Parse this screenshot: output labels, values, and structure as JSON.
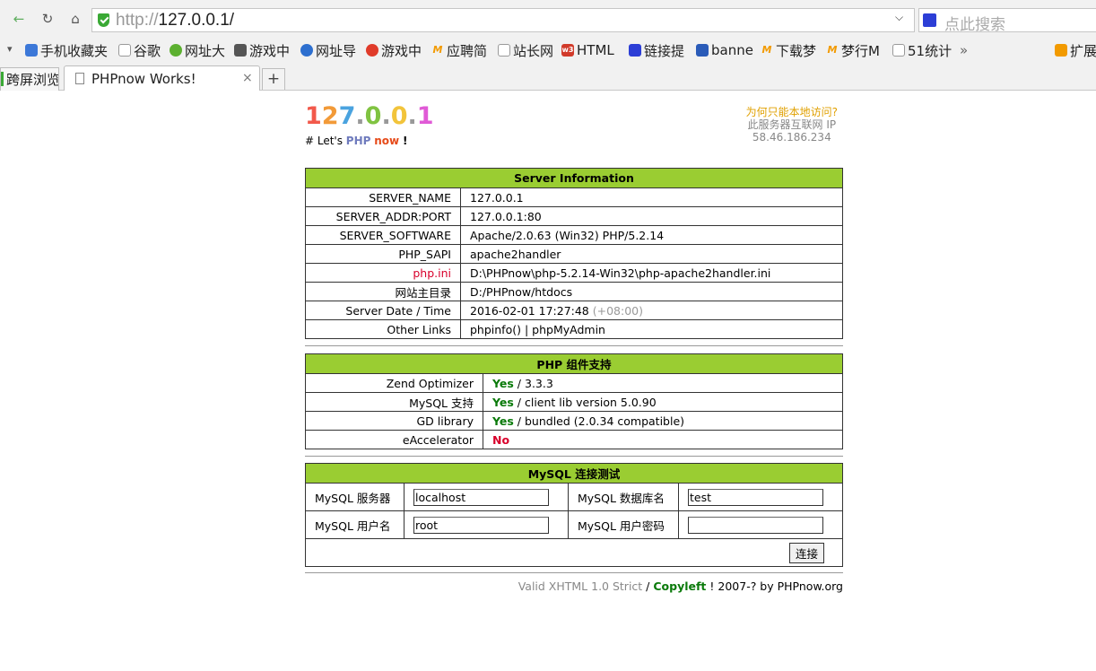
{
  "browser": {
    "url_protocol": "http://",
    "url_host": "127.0.0.1/",
    "search_placeholder": "点此搜索",
    "bookmarks": [
      "手机收藏夹",
      "谷歌",
      "网址大",
      "游戏中",
      "网址导",
      "游戏中",
      "应聘简",
      "站长网",
      "HTML",
      "链接提",
      "banne",
      "下载梦",
      "梦行M",
      "51统计",
      "扩展"
    ],
    "bookmark_overflow": "»",
    "left_ext": "跨屏浏览",
    "tab_title": "PHPnow Works!",
    "tab_close": "×",
    "new_tab": "+"
  },
  "header": {
    "logo_chars": [
      "1",
      "2",
      "7",
      ".",
      "0",
      ".",
      "0",
      ".",
      "1"
    ],
    "tagline_prefix": "# Let's ",
    "tagline_php": "PHP",
    "tagline_now": "now",
    "tagline_bang": "!",
    "ip_question": "为何只能本地访问?",
    "ip_label": "此服务器互联网 IP",
    "ip_value": "58.46.186.234"
  },
  "server_info": {
    "title": "Server Information",
    "rows": [
      {
        "key": "SERVER_NAME",
        "value": "127.0.0.1"
      },
      {
        "key": "SERVER_ADDR:PORT",
        "value": "127.0.0.1:80"
      },
      {
        "key": "SERVER_SOFTWARE",
        "value": "Apache/2.0.63 (Win32) PHP/5.2.14"
      },
      {
        "key": "PHP_SAPI",
        "value": "apache2handler"
      },
      {
        "key": "php.ini",
        "value": "D:\\PHPnow\\php-5.2.14-Win32\\php-apache2handler.ini"
      },
      {
        "key": "网站主目录",
        "value": "D:/PHPnow/htdocs"
      },
      {
        "key": "Server Date / Time",
        "value": "2016-02-01 17:27:48",
        "extra": "(+08:00)"
      },
      {
        "key": "Other Links",
        "value": "phpinfo() | phpMyAdmin"
      }
    ]
  },
  "php_support": {
    "title": "PHP 组件支持",
    "rows": [
      {
        "key": "Zend Optimizer",
        "status": "Yes",
        "detail": " / 3.3.3"
      },
      {
        "key": "MySQL 支持",
        "status": "Yes",
        "detail": " / client lib version 5.0.90"
      },
      {
        "key": "GD library",
        "status": "Yes",
        "detail": " / bundled (2.0.34 compatible)"
      },
      {
        "key": "eAccelerator",
        "status": "No",
        "detail": ""
      }
    ]
  },
  "mysql_test": {
    "title": "MySQL 连接测试",
    "server_label": "MySQL 服务器",
    "server_value": "localhost",
    "db_label": "MySQL 数据库名",
    "db_value": "test",
    "user_label": "MySQL 用户名",
    "user_value": "root",
    "pass_label": "MySQL 用户密码",
    "pass_value": "",
    "connect_button": "连接"
  },
  "footer": {
    "valid": "Valid XHTML 1.0 Strict",
    "slash": " / ",
    "copyleft": "Copyleft",
    "rest": " ! 2007-? by PHPnow.org"
  },
  "colors": {
    "table_header": "#9acd32",
    "yes": "#0a7a0a",
    "no": "#d8002b",
    "logo": [
      "#f2594b",
      "#f29a38",
      "#4aa3df",
      "#999999",
      "#80c341",
      "#999999",
      "#f2c43b",
      "#999999",
      "#e05ad6"
    ]
  }
}
